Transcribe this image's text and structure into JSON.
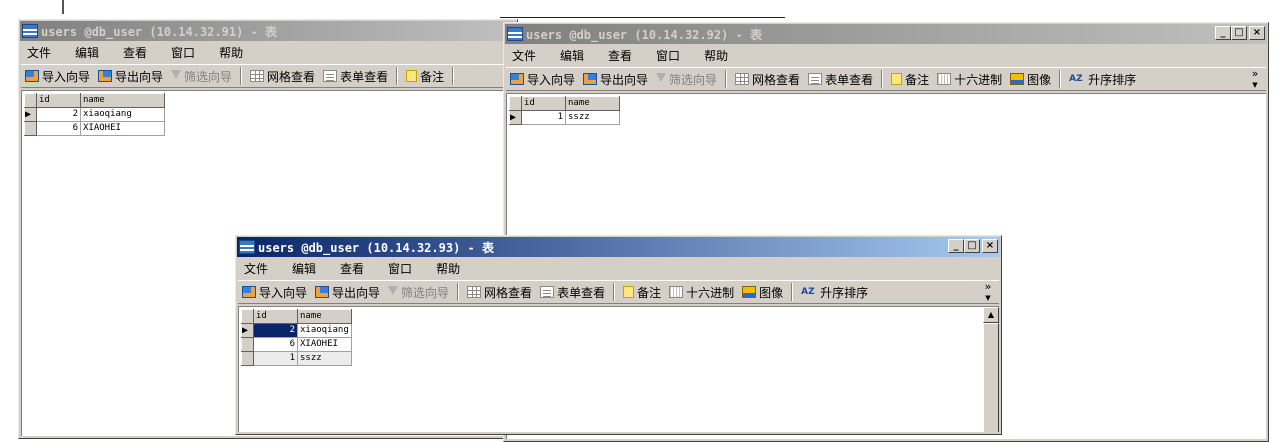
{
  "windows": {
    "w91": {
      "title": "users @db_user (10.14.32.91) - 表",
      "menu": [
        "文件",
        "编辑",
        "查看",
        "窗口",
        "帮助"
      ],
      "toolbar": {
        "import": "导入向导",
        "export": "导出向导",
        "filter": "筛选向导",
        "grid_view": "网格查看",
        "form_view": "表单查看",
        "memo": "备注"
      },
      "columns": [
        "id",
        "name"
      ],
      "rows": [
        {
          "id": "2",
          "name": "xiaoqiang"
        },
        {
          "id": "6",
          "name": "XIAOHEI"
        }
      ]
    },
    "w92": {
      "title": "users @db_user (10.14.32.92) - 表",
      "menu": [
        "文件",
        "编辑",
        "查看",
        "窗口",
        "帮助"
      ],
      "toolbar": {
        "import": "导入向导",
        "export": "导出向导",
        "filter": "筛选向导",
        "grid_view": "网格查看",
        "form_view": "表单查看",
        "memo": "备注",
        "hex": "十六进制",
        "image": "图像",
        "sort": "升序排序",
        "more": "»"
      },
      "columns": [
        "id",
        "name"
      ],
      "rows": [
        {
          "id": "1",
          "name": "sszz"
        }
      ]
    },
    "w93": {
      "title": "users @db_user (10.14.32.93) - 表",
      "menu": [
        "文件",
        "编辑",
        "查看",
        "窗口",
        "帮助"
      ],
      "toolbar": {
        "import": "导入向导",
        "export": "导出向导",
        "filter": "筛选向导",
        "grid_view": "网格查看",
        "form_view": "表单查看",
        "memo": "备注",
        "hex": "十六进制",
        "image": "图像",
        "sort": "升序排序",
        "more": "»"
      },
      "columns": [
        "id",
        "name"
      ],
      "rows": [
        {
          "id": "2",
          "name": "xiaoqiang"
        },
        {
          "id": "6",
          "name": "XIAOHEI"
        },
        {
          "id": "1",
          "name": "sszz"
        }
      ]
    }
  },
  "controls": {
    "minimize": "_",
    "maximize": "□",
    "close": "×"
  },
  "sort_icon_text": "AZ",
  "row_pointer": "▶",
  "scroll_up": "▲",
  "colors": {
    "active_title": "#0a246a",
    "inactive_title": "#808080",
    "chrome": "#d4d0c8",
    "selection": "#0a246a"
  },
  "icons": [
    "table-icon",
    "import-icon",
    "export-icon",
    "filter-icon",
    "grid-icon",
    "form-icon",
    "memo-icon",
    "hex-icon",
    "image-icon",
    "sort-asc-icon"
  ]
}
